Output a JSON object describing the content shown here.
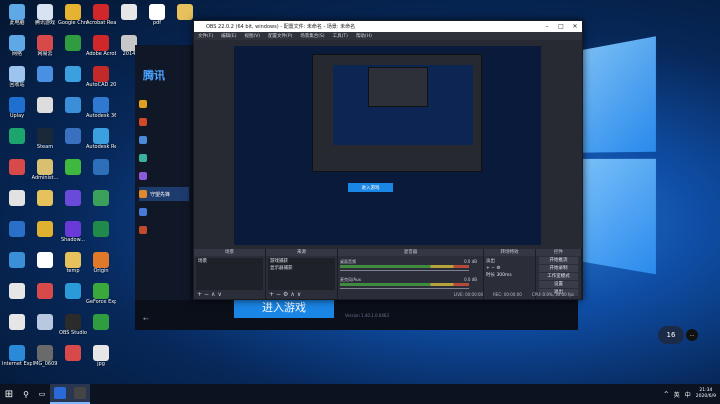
{
  "colors": {
    "accent": "#1a86e6",
    "taskbar": "#0b1220",
    "obs_bg": "#272a33"
  },
  "desktop": {
    "icons": [
      {
        "label": "此电脑",
        "icon": "computer-icon",
        "color": "#5fa8e6",
        "col": 0,
        "row": 0
      },
      {
        "label": "腾讯游戏",
        "icon": "game-icon",
        "color": "#d8e3f2",
        "col": 1,
        "row": 0
      },
      {
        "label": "Google Chrome",
        "icon": "chrome-icon",
        "color": "#e6b232",
        "col": 2,
        "row": 0
      },
      {
        "label": "Acrobat Reader DC",
        "icon": "acrobat-icon",
        "color": "#d0282a",
        "col": 3,
        "row": 0
      },
      {
        "label": "",
        "icon": "file-icon",
        "color": "#e6e6e6",
        "col": 4,
        "row": 0
      },
      {
        "label": "pdf",
        "icon": "file-icon",
        "color": "#ffffff",
        "col": 5,
        "row": 0
      },
      {
        "label": "",
        "icon": "folder-icon",
        "color": "#e6c15c",
        "col": 6,
        "row": 0
      },
      {
        "label": "网络",
        "icon": "network-icon",
        "color": "#5fa8e6",
        "col": 0,
        "row": 1
      },
      {
        "label": "网易云",
        "icon": "app-icon",
        "color": "#d84a4a",
        "col": 1,
        "row": 1
      },
      {
        "label": "",
        "icon": "app-icon",
        "color": "#2e9c3f",
        "col": 2,
        "row": 1
      },
      {
        "label": "Adobe Acrobat",
        "icon": "acrobat-icon",
        "color": "#d0282a",
        "col": 3,
        "row": 1
      },
      {
        "label": "2014",
        "icon": "app-icon",
        "color": "#c7c7c7",
        "col": 4,
        "row": 1
      },
      {
        "label": "回收站",
        "icon": "recycle-bin-icon",
        "color": "#9cc4ef",
        "col": 0,
        "row": 2
      },
      {
        "label": "",
        "icon": "app-icon",
        "color": "#4a90e2",
        "col": 1,
        "row": 2
      },
      {
        "label": "",
        "icon": "app-icon",
        "color": "#3aa0e0",
        "col": 2,
        "row": 2
      },
      {
        "label": "AutoCAD 2014",
        "icon": "autocad-icon",
        "color": "#c22a2a",
        "col": 3,
        "row": 2
      },
      {
        "label": "Uplay",
        "icon": "uplay-icon",
        "color": "#1e6fd0",
        "col": 0,
        "row": 3
      },
      {
        "label": "",
        "icon": "app-icon",
        "color": "#dddddd",
        "col": 1,
        "row": 3
      },
      {
        "label": "",
        "icon": "app-icon",
        "color": "#3a8fd8",
        "col": 2,
        "row": 3
      },
      {
        "label": "Autodesk 360",
        "icon": "autodesk-icon",
        "color": "#2f7ad0",
        "col": 3,
        "row": 3
      },
      {
        "label": "",
        "icon": "app-icon",
        "color": "#1ea56e",
        "col": 0,
        "row": 4
      },
      {
        "label": "Steam",
        "icon": "steam-icon",
        "color": "#1b2838",
        "col": 1,
        "row": 4
      },
      {
        "label": "",
        "icon": "app-icon",
        "color": "#3a70c0",
        "col": 2,
        "row": 4
      },
      {
        "label": "Autodesk ReCap",
        "icon": "autodesk-icon",
        "color": "#3aa0e0",
        "col": 3,
        "row": 4
      },
      {
        "label": "",
        "icon": "app-icon",
        "color": "#d84a4a",
        "col": 0,
        "row": 5
      },
      {
        "label": "Administ...",
        "icon": "user-icon",
        "color": "#d8c070",
        "col": 1,
        "row": 5
      },
      {
        "label": "",
        "icon": "wechat-icon",
        "color": "#3fb83f",
        "col": 2,
        "row": 5
      },
      {
        "label": "",
        "icon": "app-icon",
        "color": "#2d6fb8",
        "col": 3,
        "row": 5
      },
      {
        "label": "",
        "icon": "app-icon",
        "color": "#e2e2e2",
        "col": 0,
        "row": 6
      },
      {
        "label": "",
        "icon": "folder-icon",
        "color": "#e6c15c",
        "col": 1,
        "row": 6
      },
      {
        "label": "",
        "icon": "app-icon",
        "color": "#6a4ad8",
        "col": 2,
        "row": 6
      },
      {
        "label": "",
        "icon": "app-icon",
        "color": "#3aa05a",
        "col": 3,
        "row": 6
      },
      {
        "label": "",
        "icon": "app-icon",
        "color": "#2a70c8",
        "col": 0,
        "row": 7
      },
      {
        "label": "",
        "icon": "app-icon",
        "color": "#e0b030",
        "col": 1,
        "row": 7
      },
      {
        "label": "Shadow...",
        "icon": "app-icon",
        "color": "#6a3ad8",
        "col": 2,
        "row": 7
      },
      {
        "label": "",
        "icon": "app-icon",
        "color": "#1f8a4a",
        "col": 3,
        "row": 7
      },
      {
        "label": "",
        "icon": "app-icon",
        "color": "#3a8fd8",
        "col": 0,
        "row": 8
      },
      {
        "label": "",
        "icon": "app-icon",
        "color": "#ffffff",
        "col": 1,
        "row": 8
      },
      {
        "label": "temp",
        "icon": "folder-icon",
        "color": "#e6c15c",
        "col": 2,
        "row": 8
      },
      {
        "label": "Origin",
        "icon": "origin-icon",
        "color": "#e07a2a",
        "col": 3,
        "row": 8
      },
      {
        "label": "",
        "icon": "app-icon",
        "color": "#e6e6e6",
        "col": 0,
        "row": 9
      },
      {
        "label": "",
        "icon": "app-icon",
        "color": "#d84a4a",
        "col": 1,
        "row": 9
      },
      {
        "label": "",
        "icon": "app-icon",
        "color": "#2a9ad8",
        "col": 2,
        "row": 9
      },
      {
        "label": "GeForce Experience",
        "icon": "geforce-icon",
        "color": "#3aa83a",
        "col": 3,
        "row": 9
      },
      {
        "label": "",
        "icon": "app-icon",
        "color": "#e6e6e6",
        "col": 0,
        "row": 10
      },
      {
        "label": "",
        "icon": "app-icon",
        "color": "#b8c8e0",
        "col": 1,
        "row": 10
      },
      {
        "label": "OBS Studio",
        "icon": "obs-icon",
        "color": "#2b2b2b",
        "col": 2,
        "row": 10
      },
      {
        "label": "",
        "icon": "app-icon",
        "color": "#2e9c3f",
        "col": 3,
        "row": 10
      },
      {
        "label": "Internet Explorer",
        "icon": "ie-icon",
        "color": "#2a8ad8",
        "col": 0,
        "row": 11
      },
      {
        "label": "IMG_0609",
        "icon": "image-icon",
        "color": "#6a6a6a",
        "col": 1,
        "row": 11
      },
      {
        "label": "",
        "icon": "app-icon",
        "color": "#d84a4a",
        "col": 2,
        "row": 11
      },
      {
        "label": "jpg",
        "icon": "file-icon",
        "color": "#e6e6e6",
        "col": 3,
        "row": 11
      }
    ]
  },
  "launcher": {
    "brand": "腾讯",
    "games": [
      {
        "label": "",
        "color": "#e0a020"
      },
      {
        "label": "",
        "color": "#d04a2a"
      },
      {
        "label": "",
        "color": "#4a8ad8"
      },
      {
        "label": "",
        "color": "#3ab0a0"
      },
      {
        "label": "",
        "color": "#8a5ad8"
      },
      {
        "label": "守望先锋",
        "color": "#e08a2a",
        "active": true
      },
      {
        "label": "",
        "color": "#4a7ad8"
      },
      {
        "label": "",
        "color": "#c04a2a"
      }
    ],
    "enter_button": "进入游戏",
    "version": "Version 1.40.1.0.0463"
  },
  "obs": {
    "title": "OBS 22.0.2 (64 bit, windows) - 配置文件: 未命名 - 场景: 未命名",
    "menu": [
      "文件(F)",
      "编辑(E)",
      "视图(V)",
      "配置文件(P)",
      "场景集合(S)",
      "工具(T)",
      "帮助(H)"
    ],
    "inner_button": "进入游戏",
    "docks": {
      "scenes_title": "场景",
      "scenes": [
        "场景"
      ],
      "sources_title": "来源",
      "sources": [
        "游戏捕获",
        "显示器捕获"
      ],
      "mixer_title": "混音器",
      "mixer": [
        {
          "label": "桌面音频",
          "db": "0.0 dB"
        },
        {
          "label": "麦克风/Aux",
          "db": "0.0 dB"
        }
      ],
      "transitions_title": "转场特效",
      "transition_value": "淡出",
      "duration_label": "时长",
      "duration_value": "300ms",
      "controls_title": "控件",
      "controls": [
        "开始推流",
        "开始录制",
        "工作室模式",
        "设置",
        "退出"
      ]
    },
    "status": [
      "LIVE: 00:00:00",
      "REC: 00:00:00",
      "CPU: 0.0%, 30.00 fps"
    ]
  },
  "notification": "16",
  "taskbar": {
    "start_icon": "windows-icon",
    "search_icon": "search-icon",
    "apps": [
      {
        "icon": "game-launcher-icon",
        "color": "#2a6ad8",
        "active": true
      },
      {
        "icon": "obs-icon",
        "color": "#444",
        "active": true
      }
    ],
    "tray": [
      "^",
      "英",
      "中"
    ],
    "clock_time": "21:34",
    "clock_date": "2020/6/9"
  }
}
